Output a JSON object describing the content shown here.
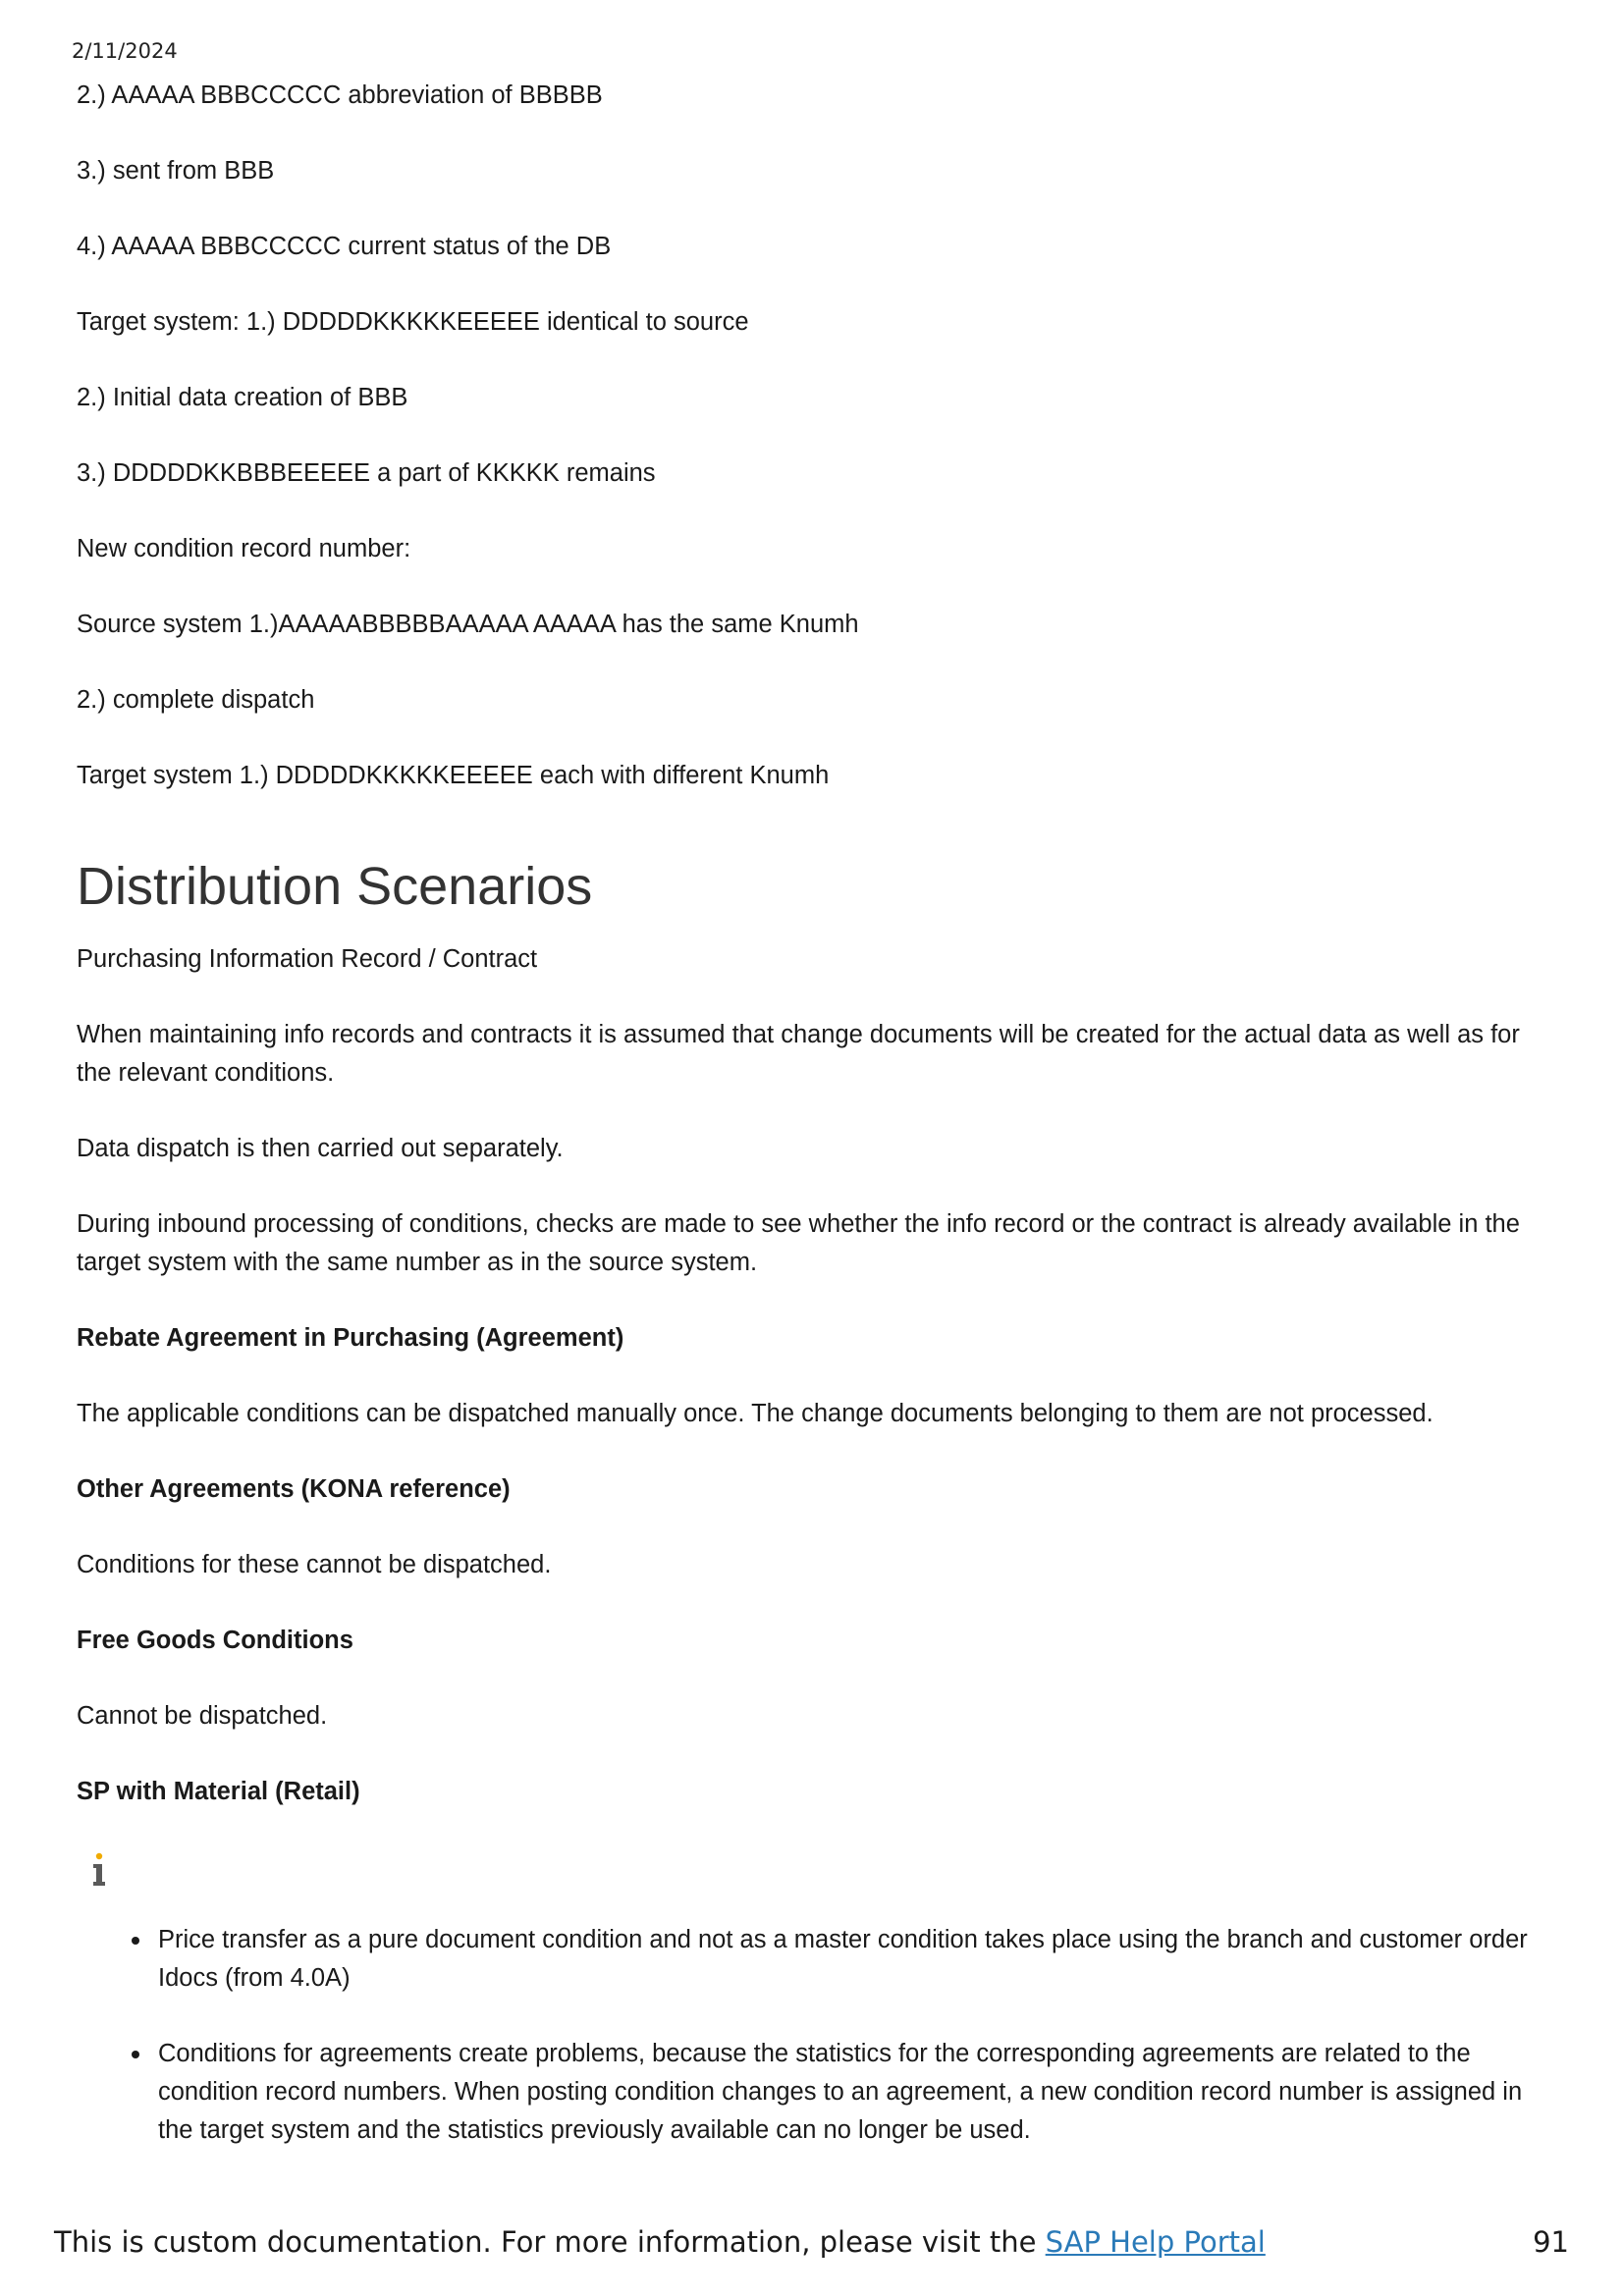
{
  "header": {
    "date": "2/11/2024"
  },
  "lines_top": [
    "2.) AAAAA BBBCCCCC abbreviation of BBBBB",
    "3.) sent from BBB",
    "4.) AAAAA BBBCCCCC current status of the DB",
    "Target system: 1.) DDDDDKKKKKEEEEE identical to source",
    "2.) Initial data creation of BBB",
    "3.) DDDDDKKBBBEEEEE a part of KKKKK remains",
    "New condition record number:",
    "Source system 1.)AAAAABBBBBAAAAA AAAAA has the same Knumh",
    "2.) complete dispatch",
    "Target system 1.) DDDDDKKKKKEEEEE each with different Knumh"
  ],
  "section": {
    "title": "Distribution Scenarios",
    "subtitle": "Purchasing Information Record / Contract",
    "para1": "When maintaining info records and contracts it is assumed that change documents will be created for the actual data as well as for the relevant conditions.",
    "para2": "Data dispatch is then carried out separately.",
    "para3": "During inbound processing of conditions, checks are made to see whether the info record or the contract is already available in the target system with the same number as in the source system.",
    "rebate_heading": "Rebate Agreement in Purchasing (Agreement)",
    "rebate_text": "The applicable conditions can be dispatched manually once. The change documents belonging to them are not processed.",
    "other_heading": "Other Agreements (KONA reference)",
    "other_text": "Conditions for these cannot be dispatched.",
    "free_heading": "Free Goods Conditions",
    "free_text": "Cannot be dispatched.",
    "sp_heading": "SP with Material (Retail)",
    "info_icon": "info-icon",
    "bullets": [
      "Price transfer as a pure document condition and not as a master condition takes place using the branch and customer order Idocs (from 4.0A)",
      "Conditions for agreements create problems, because the statistics for the corresponding agreements are related to the condition record numbers. When posting condition changes to an agreement, a new condition record number is assigned in the target system and the statistics previously available can no longer be used."
    ]
  },
  "footer": {
    "text": "This is custom documentation. For more information, please visit the",
    "link_label": "SAP Help Portal",
    "page_number": "91",
    "link_color": "#2a7ab8"
  }
}
